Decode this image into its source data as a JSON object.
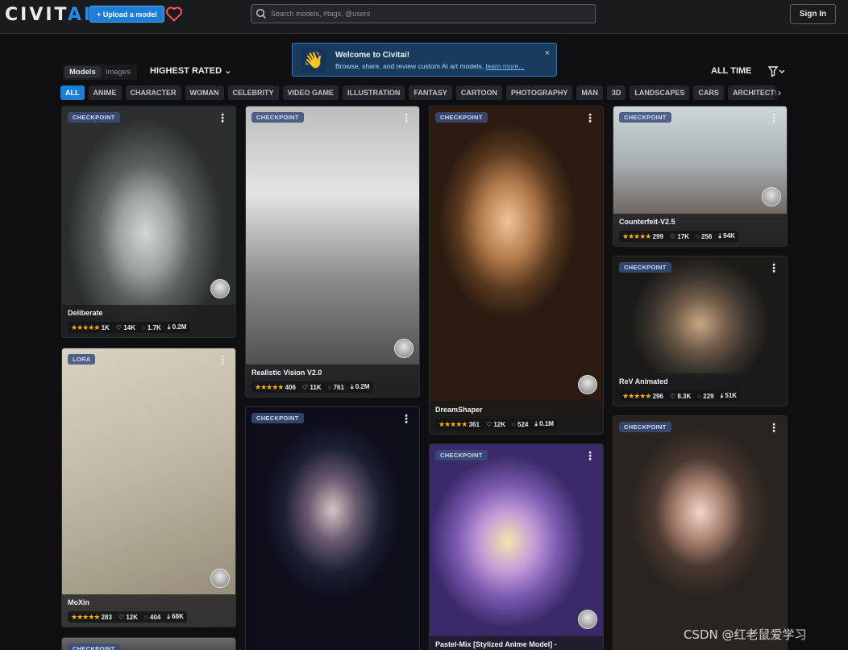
{
  "header": {
    "logo_main": "CIVIT",
    "logo_accent": "AI",
    "upload_label": "+ Upload a model",
    "search_placeholder": "Search models, #tags, @users",
    "signin_label": "Sign In"
  },
  "banner": {
    "title": "Welcome to Civitai!",
    "subtitle": "Browse, share, and review custom AI art models,",
    "link": "learn more...",
    "close": "×"
  },
  "toolbar": {
    "tab_models": "Models",
    "tab_images": "Images",
    "sort_label": "HIGHEST RATED",
    "period_label": "ALL TIME"
  },
  "categories": [
    "ALL",
    "ANIME",
    "CHARACTER",
    "WOMAN",
    "CELEBRITY",
    "VIDEO GAME",
    "ILLUSTRATION",
    "FANTASY",
    "CARTOON",
    "PHOTOGRAPHY",
    "MAN",
    "3D",
    "LANDSCAPES",
    "CARS",
    "ARCHITECTURE"
  ],
  "cards": [
    {
      "type": "CHECKPOINT",
      "name": "Deliberate",
      "rating": "1K",
      "likes": "14K",
      "comments": "1.7K",
      "downloads": "0.2M"
    },
    {
      "type": "LORA",
      "name": "MoXin",
      "rating": "283",
      "likes": "12K",
      "comments": "404",
      "downloads": "68K"
    },
    {
      "type": "CHECKPOINT",
      "name": "",
      "rating": "",
      "likes": "",
      "comments": "",
      "downloads": ""
    },
    {
      "type": "CHECKPOINT",
      "name": "Realistic Vision V2.0",
      "rating": "406",
      "likes": "11K",
      "comments": "761",
      "downloads": "0.2M"
    },
    {
      "type": "CHECKPOINT",
      "name": "",
      "rating": "",
      "likes": "",
      "comments": "",
      "downloads": ""
    },
    {
      "type": "CHECKPOINT",
      "name": "DreamShaper",
      "rating": "361",
      "likes": "12K",
      "comments": "524",
      "downloads": "0.1M"
    },
    {
      "type": "CHECKPOINT",
      "name": "Pastel-Mix [Stylized Anime Model] -",
      "rating": "",
      "likes": "",
      "comments": "",
      "downloads": ""
    },
    {
      "type": "CHECKPOINT",
      "name": "Counterfeit-V2.5",
      "rating": "299",
      "likes": "17K",
      "comments": "256",
      "downloads": "94K"
    },
    {
      "type": "CHECKPOINT",
      "name": "ReV Animated",
      "rating": "296",
      "likes": "8.3K",
      "comments": "229",
      "downloads": "51K"
    },
    {
      "type": "CHECKPOINT",
      "name": "",
      "rating": "",
      "likes": "",
      "comments": "",
      "downloads": ""
    }
  ],
  "watermark": "CSDN @红老鼠爱学习",
  "colors": {
    "accent": "#1c7ed6",
    "background": "#0f0f11",
    "star": "#fab005",
    "heart": "#fa5252"
  }
}
